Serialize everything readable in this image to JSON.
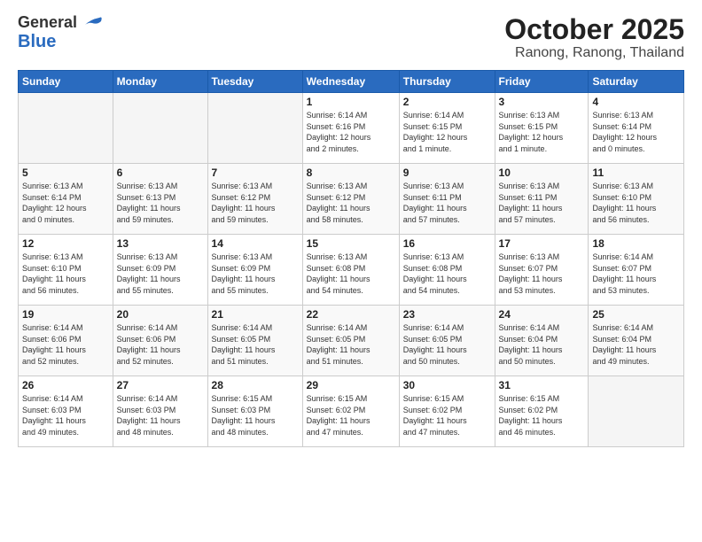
{
  "logo": {
    "line1": "General",
    "line2": "Blue"
  },
  "title": "October 2025",
  "location": "Ranong, Ranong, Thailand",
  "days_of_week": [
    "Sunday",
    "Monday",
    "Tuesday",
    "Wednesday",
    "Thursday",
    "Friday",
    "Saturday"
  ],
  "weeks": [
    [
      {
        "day": "",
        "info": ""
      },
      {
        "day": "",
        "info": ""
      },
      {
        "day": "",
        "info": ""
      },
      {
        "day": "1",
        "info": "Sunrise: 6:14 AM\nSunset: 6:16 PM\nDaylight: 12 hours\nand 2 minutes."
      },
      {
        "day": "2",
        "info": "Sunrise: 6:14 AM\nSunset: 6:15 PM\nDaylight: 12 hours\nand 1 minute."
      },
      {
        "day": "3",
        "info": "Sunrise: 6:13 AM\nSunset: 6:15 PM\nDaylight: 12 hours\nand 1 minute."
      },
      {
        "day": "4",
        "info": "Sunrise: 6:13 AM\nSunset: 6:14 PM\nDaylight: 12 hours\nand 0 minutes."
      }
    ],
    [
      {
        "day": "5",
        "info": "Sunrise: 6:13 AM\nSunset: 6:14 PM\nDaylight: 12 hours\nand 0 minutes."
      },
      {
        "day": "6",
        "info": "Sunrise: 6:13 AM\nSunset: 6:13 PM\nDaylight: 11 hours\nand 59 minutes."
      },
      {
        "day": "7",
        "info": "Sunrise: 6:13 AM\nSunset: 6:12 PM\nDaylight: 11 hours\nand 59 minutes."
      },
      {
        "day": "8",
        "info": "Sunrise: 6:13 AM\nSunset: 6:12 PM\nDaylight: 11 hours\nand 58 minutes."
      },
      {
        "day": "9",
        "info": "Sunrise: 6:13 AM\nSunset: 6:11 PM\nDaylight: 11 hours\nand 57 minutes."
      },
      {
        "day": "10",
        "info": "Sunrise: 6:13 AM\nSunset: 6:11 PM\nDaylight: 11 hours\nand 57 minutes."
      },
      {
        "day": "11",
        "info": "Sunrise: 6:13 AM\nSunset: 6:10 PM\nDaylight: 11 hours\nand 56 minutes."
      }
    ],
    [
      {
        "day": "12",
        "info": "Sunrise: 6:13 AM\nSunset: 6:10 PM\nDaylight: 11 hours\nand 56 minutes."
      },
      {
        "day": "13",
        "info": "Sunrise: 6:13 AM\nSunset: 6:09 PM\nDaylight: 11 hours\nand 55 minutes."
      },
      {
        "day": "14",
        "info": "Sunrise: 6:13 AM\nSunset: 6:09 PM\nDaylight: 11 hours\nand 55 minutes."
      },
      {
        "day": "15",
        "info": "Sunrise: 6:13 AM\nSunset: 6:08 PM\nDaylight: 11 hours\nand 54 minutes."
      },
      {
        "day": "16",
        "info": "Sunrise: 6:13 AM\nSunset: 6:08 PM\nDaylight: 11 hours\nand 54 minutes."
      },
      {
        "day": "17",
        "info": "Sunrise: 6:13 AM\nSunset: 6:07 PM\nDaylight: 11 hours\nand 53 minutes."
      },
      {
        "day": "18",
        "info": "Sunrise: 6:14 AM\nSunset: 6:07 PM\nDaylight: 11 hours\nand 53 minutes."
      }
    ],
    [
      {
        "day": "19",
        "info": "Sunrise: 6:14 AM\nSunset: 6:06 PM\nDaylight: 11 hours\nand 52 minutes."
      },
      {
        "day": "20",
        "info": "Sunrise: 6:14 AM\nSunset: 6:06 PM\nDaylight: 11 hours\nand 52 minutes."
      },
      {
        "day": "21",
        "info": "Sunrise: 6:14 AM\nSunset: 6:05 PM\nDaylight: 11 hours\nand 51 minutes."
      },
      {
        "day": "22",
        "info": "Sunrise: 6:14 AM\nSunset: 6:05 PM\nDaylight: 11 hours\nand 51 minutes."
      },
      {
        "day": "23",
        "info": "Sunrise: 6:14 AM\nSunset: 6:05 PM\nDaylight: 11 hours\nand 50 minutes."
      },
      {
        "day": "24",
        "info": "Sunrise: 6:14 AM\nSunset: 6:04 PM\nDaylight: 11 hours\nand 50 minutes."
      },
      {
        "day": "25",
        "info": "Sunrise: 6:14 AM\nSunset: 6:04 PM\nDaylight: 11 hours\nand 49 minutes."
      }
    ],
    [
      {
        "day": "26",
        "info": "Sunrise: 6:14 AM\nSunset: 6:03 PM\nDaylight: 11 hours\nand 49 minutes."
      },
      {
        "day": "27",
        "info": "Sunrise: 6:14 AM\nSunset: 6:03 PM\nDaylight: 11 hours\nand 48 minutes."
      },
      {
        "day": "28",
        "info": "Sunrise: 6:15 AM\nSunset: 6:03 PM\nDaylight: 11 hours\nand 48 minutes."
      },
      {
        "day": "29",
        "info": "Sunrise: 6:15 AM\nSunset: 6:02 PM\nDaylight: 11 hours\nand 47 minutes."
      },
      {
        "day": "30",
        "info": "Sunrise: 6:15 AM\nSunset: 6:02 PM\nDaylight: 11 hours\nand 47 minutes."
      },
      {
        "day": "31",
        "info": "Sunrise: 6:15 AM\nSunset: 6:02 PM\nDaylight: 11 hours\nand 46 minutes."
      },
      {
        "day": "",
        "info": ""
      }
    ]
  ]
}
